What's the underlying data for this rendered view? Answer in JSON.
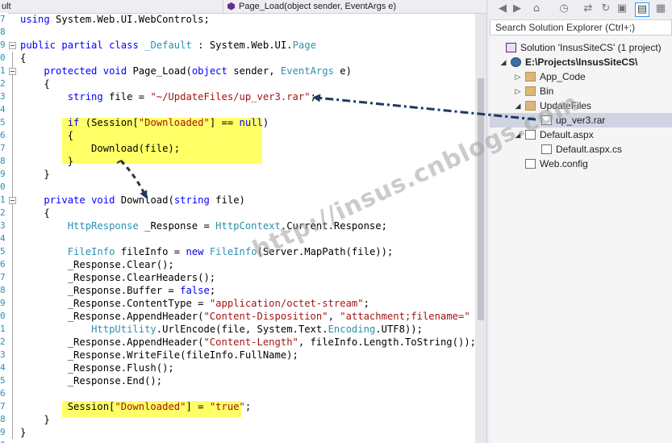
{
  "colors": {
    "keyword": "#0000ff",
    "type": "#2b91af",
    "string": "#a31515",
    "highlight": "#ffff66",
    "arrow": "#1f3864",
    "selected_row": "#cfd3e2"
  },
  "nav": {
    "class_combo": "ult",
    "member_combo": "Page_Load(object sender, EventArgs e)"
  },
  "line_numbers": [
    "7",
    "8",
    "9",
    "0",
    "1",
    "2",
    "3",
    "4",
    "5",
    "6",
    "7",
    "8",
    "9",
    "0",
    "1",
    "2",
    "3",
    "4",
    "5",
    "6",
    "7",
    "8",
    "9",
    "0",
    "1",
    "2",
    "3",
    "4",
    "5",
    "6",
    "7",
    "8",
    "9",
    "0"
  ],
  "code": {
    "l1": [
      {
        "t": "using",
        "c": "kw"
      },
      {
        "t": " System.Web.UI.WebControls;"
      }
    ],
    "l3": [
      {
        "t": "public",
        "c": "kw"
      },
      {
        "t": " "
      },
      {
        "t": "partial",
        "c": "kw"
      },
      {
        "t": " "
      },
      {
        "t": "class",
        "c": "kw"
      },
      {
        "t": " "
      },
      {
        "t": "_Default",
        "c": "ty"
      },
      {
        "t": " : System.Web.UI."
      },
      {
        "t": "Page",
        "c": "ty"
      }
    ],
    "l4": [
      {
        "t": "{"
      }
    ],
    "l5": [
      {
        "t": "    "
      },
      {
        "t": "protected",
        "c": "kw"
      },
      {
        "t": " "
      },
      {
        "t": "void",
        "c": "kw"
      },
      {
        "t": " Page_Load("
      },
      {
        "t": "object",
        "c": "kw"
      },
      {
        "t": " sender, "
      },
      {
        "t": "EventArgs",
        "c": "ty"
      },
      {
        "t": " e)"
      }
    ],
    "l6": [
      {
        "t": "    {"
      }
    ],
    "l7": [
      {
        "t": "        "
      },
      {
        "t": "string",
        "c": "kw"
      },
      {
        "t": " file = "
      },
      {
        "t": "\"~/UpdateFiles/up_ver3.rar\"",
        "c": "st"
      },
      {
        "t": ";"
      }
    ],
    "l9": [
      {
        "t": "        "
      },
      {
        "t": "if",
        "c": "kw"
      },
      {
        "t": " (Session["
      },
      {
        "t": "\"Downloaded\"",
        "c": "st"
      },
      {
        "t": "] == "
      },
      {
        "t": "null",
        "c": "kw"
      },
      {
        "t": ")"
      }
    ],
    "l10": [
      {
        "t": "        {"
      }
    ],
    "l11": [
      {
        "t": "            Download(file);"
      }
    ],
    "l12": [
      {
        "t": "        }"
      }
    ],
    "l13": [
      {
        "t": "    }"
      }
    ],
    "l15": [
      {
        "t": "    "
      },
      {
        "t": "private",
        "c": "kw"
      },
      {
        "t": " "
      },
      {
        "t": "void",
        "c": "kw"
      },
      {
        "t": " Download("
      },
      {
        "t": "string",
        "c": "kw"
      },
      {
        "t": " file)"
      }
    ],
    "l16": [
      {
        "t": "    {"
      }
    ],
    "l17": [
      {
        "t": "        "
      },
      {
        "t": "HttpResponse",
        "c": "ty"
      },
      {
        "t": " _Response = "
      },
      {
        "t": "HttpContext",
        "c": "ty"
      },
      {
        "t": ".Current.Response;"
      }
    ],
    "l19": [
      {
        "t": "        "
      },
      {
        "t": "FileInfo",
        "c": "ty"
      },
      {
        "t": " fileInfo = "
      },
      {
        "t": "new",
        "c": "kw"
      },
      {
        "t": " "
      },
      {
        "t": "FileInfo",
        "c": "ty"
      },
      {
        "t": "(Server.MapPath(file));"
      }
    ],
    "l20": [
      {
        "t": "        _Response.Clear();"
      }
    ],
    "l21": [
      {
        "t": "        _Response.ClearHeaders();"
      }
    ],
    "l22": [
      {
        "t": "        _Response.Buffer = "
      },
      {
        "t": "false",
        "c": "kw"
      },
      {
        "t": ";"
      }
    ],
    "l23": [
      {
        "t": "        _Response.ContentType = "
      },
      {
        "t": "\"application/octet-stream\"",
        "c": "st"
      },
      {
        "t": ";"
      }
    ],
    "l24": [
      {
        "t": "        _Response.AppendHeader("
      },
      {
        "t": "\"Content-Disposition\"",
        "c": "st"
      },
      {
        "t": ", "
      },
      {
        "t": "\"attachment;filename=\"",
        "c": "st"
      },
      {
        "t": " +"
      }
    ],
    "l25": [
      {
        "t": "            "
      },
      {
        "t": "HttpUtility",
        "c": "ty"
      },
      {
        "t": ".UrlEncode(file, System.Text."
      },
      {
        "t": "Encoding",
        "c": "ty"
      },
      {
        "t": ".UTF8));"
      }
    ],
    "l26": [
      {
        "t": "        _Response.AppendHeader("
      },
      {
        "t": "\"Content-Length\"",
        "c": "st"
      },
      {
        "t": ", fileInfo.Length.ToString());"
      }
    ],
    "l27": [
      {
        "t": "        _Response.WriteFile(fileInfo.FullName);"
      }
    ],
    "l28": [
      {
        "t": "        _Response.Flush();"
      }
    ],
    "l29": [
      {
        "t": "        _Response.End();"
      }
    ],
    "l31": [
      {
        "t": "        Session["
      },
      {
        "t": "\"Downloaded\"",
        "c": "st"
      },
      {
        "t": "] = "
      },
      {
        "t": "\"true\"",
        "c": "st"
      },
      {
        "t": ";"
      }
    ],
    "l32": [
      {
        "t": "    }"
      }
    ],
    "l33": [
      {
        "t": "}"
      }
    ]
  },
  "solution_explorer": {
    "toolbar_icons": [
      "back-icon",
      "forward-icon",
      "home-icon",
      "history-icon",
      "sync-icon",
      "refresh-icon",
      "collapse-all-icon",
      "show-all-files-icon",
      "properties-icon"
    ],
    "search_placeholder": "Search Solution Explorer (Ctrl+;)",
    "items": [
      {
        "label": "Solution 'InsusSiteCS' (1 project)",
        "icon": "solution-icon",
        "arrow": "",
        "bold": false
      },
      {
        "label": "E:\\Projects\\InsusSiteCS\\",
        "icon": "website-icon",
        "arrow": "expanded",
        "bold": true
      },
      {
        "label": "App_Code",
        "icon": "folder-icon",
        "arrow": "collapsed",
        "bold": false
      },
      {
        "label": "Bin",
        "icon": "folder-icon",
        "arrow": "collapsed",
        "bold": false
      },
      {
        "label": "UpdateFiles",
        "icon": "folder-icon",
        "arrow": "expanded",
        "bold": false
      },
      {
        "label": "up_ver3.rar",
        "icon": "file-icon",
        "arrow": "",
        "bold": false,
        "selected": true
      },
      {
        "label": "Default.aspx",
        "icon": "aspx-file-icon",
        "arrow": "expanded",
        "bold": false
      },
      {
        "label": "Default.aspx.cs",
        "icon": "cs-file-icon",
        "arrow": "",
        "bold": false
      },
      {
        "label": "Web.config",
        "icon": "config-file-icon",
        "arrow": "",
        "bold": false
      }
    ]
  },
  "watermark": "http://insus.cnblogs.com"
}
